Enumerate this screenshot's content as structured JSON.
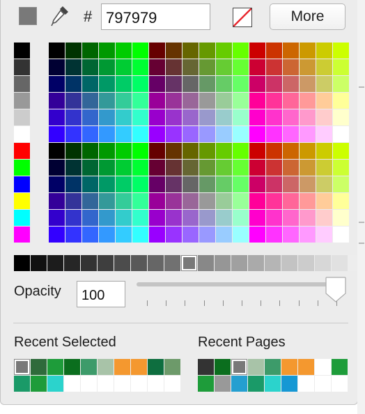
{
  "toolbar": {
    "current_color": "#797979",
    "hash_label": "#",
    "hex_value": "797979",
    "more_label": "More"
  },
  "grays_column": [
    "#000000",
    "#333333",
    "#666666",
    "#999999",
    "#cccccc",
    "#ffffff",
    "#ff0000",
    "#00ff00",
    "#0000ff",
    "#ffff00",
    "#00ffff",
    "#ff00ff"
  ],
  "palette": {
    "red_steps": [
      "00",
      "33",
      "66",
      "99",
      "cc",
      "ff"
    ],
    "green_steps": [
      "00",
      "33",
      "66",
      "99",
      "cc",
      "ff"
    ],
    "blue_steps": [
      "00",
      "33",
      "66",
      "99",
      "cc",
      "ff"
    ]
  },
  "gray_strip": [
    "#000000",
    "#111111",
    "#1c1c1c",
    "#262626",
    "#333333",
    "#3e3e3e",
    "#4c4c4c",
    "#595959",
    "#666666",
    "#717171",
    "#797979",
    "#888888",
    "#969696",
    "#a0a0a0",
    "#aaaaaa",
    "#b5b5b5",
    "#c3c3c3",
    "#cccccc",
    "#d7d7d7",
    "#e1e1e1",
    "#ededed",
    "#ffffff"
  ],
  "gray_strip_selected_index": 10,
  "opacity": {
    "label": "Opacity",
    "value": "100",
    "level_percent": 100
  },
  "recent_selected": {
    "title": "Recent Selected",
    "colors": [
      "#797979",
      "#2f6b3b",
      "#1e9c3a",
      "#0b6e1e",
      "#3d9b6a",
      "#a8c3a8",
      "#f4982f",
      "#f4982f",
      "#0e6e3f",
      "#6d9a6a",
      "#1a9a68",
      "#1e9c3a",
      "#2bd3cc",
      "#ffffff",
      "#ffffff",
      "#ffffff",
      "#ffffff",
      "#ffffff",
      "#ffffff",
      "#ffffff"
    ],
    "selected_index": 0
  },
  "recent_pages": {
    "title": "Recent Pages",
    "colors": [
      "#333333",
      "#0b6e1e",
      "#797979",
      "#a8c3a8",
      "#3d9b6a",
      "#f4982f",
      "#f4982f",
      "#ffffff",
      "#1e9c3a",
      "#1e9c3a",
      "#999999",
      "#249fd0",
      "#1a9a68",
      "#2bd3cc",
      "#1698d4",
      "#ffffff",
      "#ffffff",
      "#ffffff"
    ],
    "selected_index": 2
  }
}
